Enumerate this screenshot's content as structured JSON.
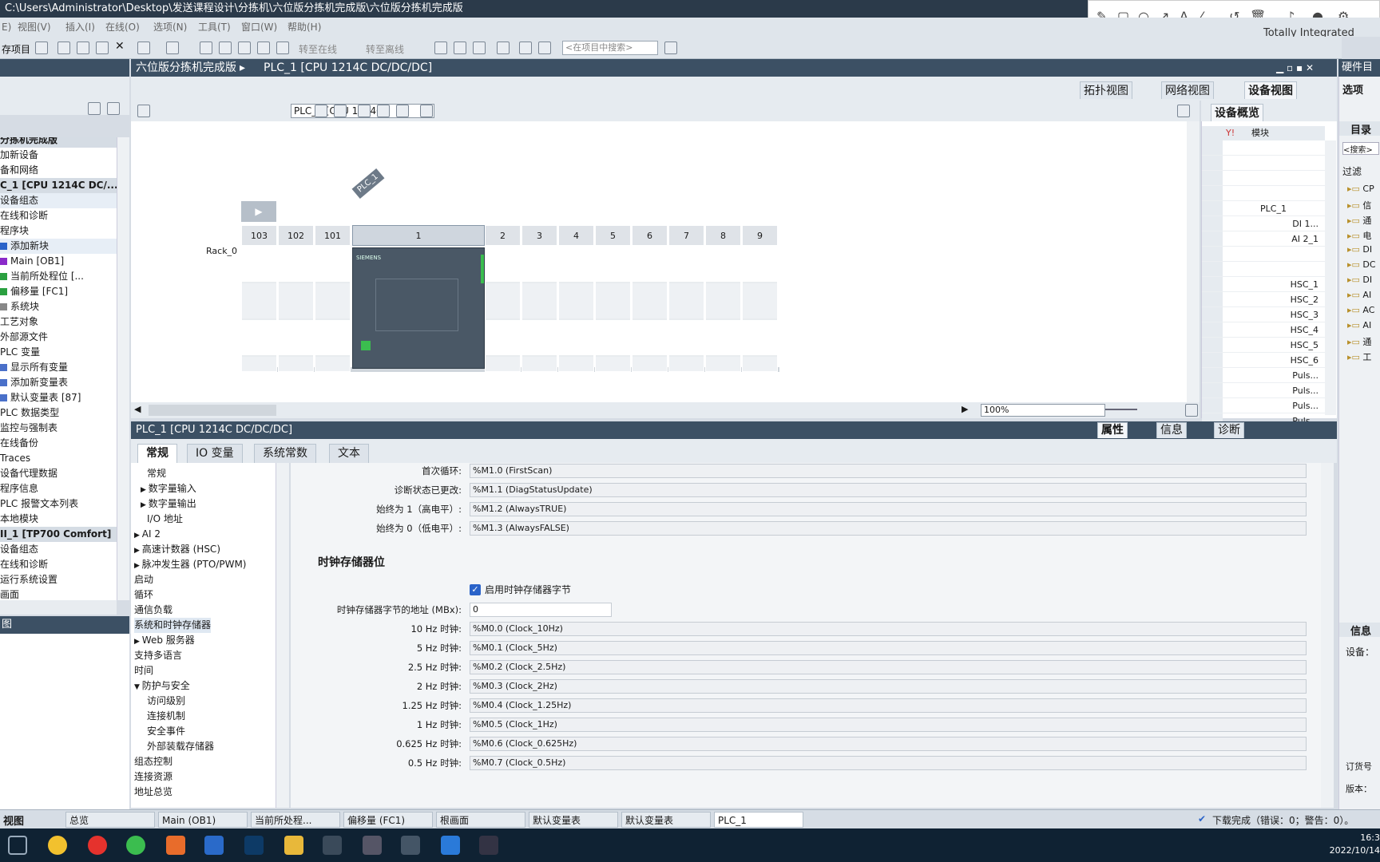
{
  "window": {
    "title": "C:\\Users\\Administrator\\Desktop\\发送课程设计\\分拣机\\六位版分拣机完成版\\六位版分拣机完成版"
  },
  "annotation_tools": [
    "pencil-icon",
    "rectangle-icon",
    "circle-icon",
    "arrow-icon",
    "text-icon",
    "highlighter-icon",
    "undo-icon",
    "trash-icon",
    "speaker-icon",
    "mic-icon",
    "settings-icon"
  ],
  "menubar": {
    "items": [
      "E)",
      "视图(V)",
      "插入(I)",
      "在线(O)",
      "选项(N)",
      "工具(T)",
      "窗口(W)",
      "帮助(H)"
    ],
    "brand": "Totally Integrated Auto"
  },
  "toolbar": {
    "save_label": "存项目",
    "go_online": "转至在线",
    "go_offline": "转至离线",
    "search_placeholder": "<在项目中搜索>"
  },
  "project_tree": {
    "items": [
      {
        "label": "分拣机完成版",
        "header": true
      },
      {
        "label": "加新设备"
      },
      {
        "label": "备和网络"
      },
      {
        "label": "C_1 [CPU 1214C DC/...",
        "header": true
      },
      {
        "label": "设备组态",
        "selected": true
      },
      {
        "label": "在线和诊断"
      },
      {
        "label": "程序块"
      },
      {
        "label": "添加新块",
        "color": "#2a63c9",
        "selected": true
      },
      {
        "label": "Main [OB1]",
        "color": "#8a2ac9"
      },
      {
        "label": "当前所处程位 [...",
        "color": "#2aa040"
      },
      {
        "label": "偏移量 [FC1]",
        "color": "#2aa040"
      },
      {
        "label": "系统块",
        "color": "#888888"
      },
      {
        "label": "工艺对象"
      },
      {
        "label": "外部源文件"
      },
      {
        "label": "PLC 变量"
      },
      {
        "label": "显示所有变量",
        "color": "#4a70c9"
      },
      {
        "label": "添加新变量表",
        "color": "#4a70c9"
      },
      {
        "label": "默认变量表 [87]",
        "color": "#4a70c9"
      },
      {
        "label": "PLC 数据类型"
      },
      {
        "label": "监控与强制表"
      },
      {
        "label": "在线备份"
      },
      {
        "label": "Traces"
      },
      {
        "label": "设备代理数据"
      },
      {
        "label": "程序信息"
      },
      {
        "label": "PLC 报警文本列表"
      },
      {
        "label": "本地模块"
      },
      {
        "label": "II_1 [TP700 Comfort]",
        "header": true
      },
      {
        "label": "设备组态"
      },
      {
        "label": "在线和诊断"
      },
      {
        "label": "运行系统设置"
      },
      {
        "label": "画面"
      }
    ]
  },
  "details_view": {
    "title": "图"
  },
  "editor": {
    "breadcrumb_root": "六位版分拣机完成版",
    "breadcrumb_device": "PLC_1 [CPU 1214C DC/DC/DC]",
    "tabs": [
      "拓扑视图",
      "网络视图",
      "设备视图"
    ],
    "device_selector": "PLC_1 [CPU 1214C]",
    "zoom": "100%"
  },
  "rack": {
    "name": "Rack_0",
    "slots": [
      "103",
      "102",
      "101",
      "1",
      "2",
      "3",
      "4",
      "5",
      "6",
      "7",
      "8",
      "9"
    ],
    "plc_label": "PLC_1",
    "brand": "SIEMENS"
  },
  "device_overview": {
    "title": "设备概览",
    "column_module": "模块",
    "rows": [
      "",
      "",
      "",
      "",
      "PLC_1",
      "DI 1...",
      "AI 2_1",
      "",
      "",
      "HSC_1",
      "HSC_2",
      "HSC_3",
      "HSC_4",
      "HSC_5",
      "HSC_6",
      "Puls...",
      "Puls...",
      "Puls...",
      "Puls..."
    ]
  },
  "properties": {
    "title": "PLC_1 [CPU 1214C DC/DC/DC]",
    "right_tabs": [
      "属性",
      "信息",
      "诊断"
    ],
    "tabs": [
      "常规",
      "IO 变量",
      "系统常数",
      "文本"
    ]
  },
  "nav_tree": [
    {
      "label": "常规",
      "indent": 2
    },
    {
      "label": "数字量输入",
      "indent": 1,
      "arrow": "▶"
    },
    {
      "label": "数字量输出",
      "indent": 1,
      "arrow": "▶"
    },
    {
      "label": "I/O 地址",
      "indent": 2
    },
    {
      "label": "AI 2",
      "indent": 0,
      "arrow": "▶"
    },
    {
      "label": "高速计数器 (HSC)",
      "indent": 0,
      "arrow": "▶"
    },
    {
      "label": "脉冲发生器 (PTO/PWM)",
      "indent": 0,
      "arrow": "▶"
    },
    {
      "label": "启动",
      "indent": 0
    },
    {
      "label": "循环",
      "indent": 0
    },
    {
      "label": "通信负载",
      "indent": 0
    },
    {
      "label": "系统和时钟存储器",
      "indent": 0,
      "selected": true
    },
    {
      "label": "Web 服务器",
      "indent": 0,
      "arrow": "▶"
    },
    {
      "label": "支持多语言",
      "indent": 0
    },
    {
      "label": "时间",
      "indent": 0
    },
    {
      "label": "防护与安全",
      "indent": 0,
      "arrow": "▼"
    },
    {
      "label": "访问级别",
      "indent": 2
    },
    {
      "label": "连接机制",
      "indent": 2
    },
    {
      "label": "安全事件",
      "indent": 2
    },
    {
      "label": "外部装载存储器",
      "indent": 2
    },
    {
      "label": "组态控制",
      "indent": 0
    },
    {
      "label": "连接资源",
      "indent": 0
    },
    {
      "label": "地址总览",
      "indent": 0
    }
  ],
  "system_bits": [
    {
      "label": "首次循环:",
      "value": "%M1.0 (FirstScan)"
    },
    {
      "label": "诊断状态已更改:",
      "value": "%M1.1 (DiagStatusUpdate)"
    },
    {
      "label": "始终为 1（高电平）:",
      "value": "%M1.2 (AlwaysTRUE)"
    },
    {
      "label": "始终为 0（低电平）:",
      "value": "%M1.3 (AlwaysFALSE)"
    }
  ],
  "clock_memory": {
    "title": "时钟存储器位",
    "enable_label": "启用时钟存储器字节",
    "enabled": true,
    "address_label": "时钟存储器字节的地址 (MBx):",
    "address_value": "0",
    "bits": [
      {
        "label": "10 Hz 时钟:",
        "value": "%M0.0 (Clock_10Hz)"
      },
      {
        "label": "5 Hz 时钟:",
        "value": "%M0.1 (Clock_5Hz)"
      },
      {
        "label": "2.5 Hz 时钟:",
        "value": "%M0.2 (Clock_2.5Hz)"
      },
      {
        "label": "2 Hz 时钟:",
        "value": "%M0.3 (Clock_2Hz)"
      },
      {
        "label": "1.25 Hz 时钟:",
        "value": "%M0.4 (Clock_1.25Hz)"
      },
      {
        "label": "1 Hz 时钟:",
        "value": "%M0.5 (Clock_1Hz)"
      },
      {
        "label": "0.625 Hz 时钟:",
        "value": "%M0.6 (Clock_0.625Hz)"
      },
      {
        "label": "0.5 Hz 时钟:",
        "value": "%M0.7 (Clock_0.5Hz)"
      }
    ]
  },
  "right_panel": {
    "title": "硬件目",
    "options": "选项",
    "catalog": "目录",
    "search": "<搜索>",
    "filter": "过滤",
    "catalog_items": [
      "CP",
      "信",
      "通",
      "电",
      "DI",
      "DC",
      "DI",
      "AI",
      "AC",
      "AI",
      "通",
      "工"
    ],
    "info": "信息",
    "device": "设备：",
    "order_no": "订货号",
    "firmware": "版本："
  },
  "portal_bar": {
    "portal_view": "视图",
    "tasks": [
      "总览",
      "Main (OB1)",
      "当前所处程...",
      "偏移量 (FC1)",
      "根画面",
      "默认变量表",
      "默认变量表",
      "PLC_1"
    ],
    "status": "下载完成（错误：0；警告：0）。"
  },
  "os_taskbar": {
    "clock": "16:3",
    "date": "2022/10/14"
  }
}
